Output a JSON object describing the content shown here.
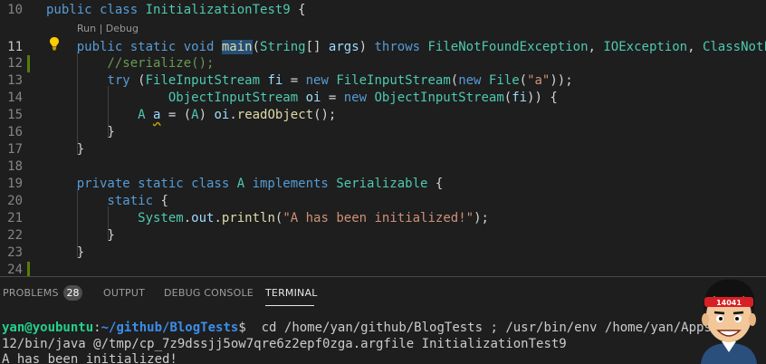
{
  "editor": {
    "codelens": "Run | Debug",
    "lines": [
      {
        "num": "10",
        "tokens": [
          {
            "t": "public class ",
            "c": "kw"
          },
          {
            "t": "InitializationTest9",
            "c": "ty"
          },
          {
            "t": " {",
            "c": "pl"
          }
        ]
      },
      {
        "num": "11",
        "tokens": [
          {
            "t": "    public static void ",
            "c": "kw"
          },
          {
            "t": "main",
            "c": "fn hl"
          },
          {
            "t": "(",
            "c": "pl"
          },
          {
            "t": "String",
            "c": "ty"
          },
          {
            "t": "[] ",
            "c": "pl"
          },
          {
            "t": "args",
            "c": "var"
          },
          {
            "t": ") ",
            "c": "pl"
          },
          {
            "t": "throws ",
            "c": "kw"
          },
          {
            "t": "FileNotFoundException",
            "c": "ty"
          },
          {
            "t": ", ",
            "c": "pl"
          },
          {
            "t": "IOException",
            "c": "ty"
          },
          {
            "t": ", ",
            "c": "pl"
          },
          {
            "t": "ClassNotF",
            "c": "ty"
          }
        ]
      },
      {
        "num": "12",
        "tokens": [
          {
            "t": "        //serialize();",
            "c": "cm"
          }
        ]
      },
      {
        "num": "13",
        "tokens": [
          {
            "t": "        try ",
            "c": "kw"
          },
          {
            "t": "(",
            "c": "pl"
          },
          {
            "t": "FileInputStream ",
            "c": "ty"
          },
          {
            "t": "fi",
            "c": "var"
          },
          {
            "t": " = ",
            "c": "pl"
          },
          {
            "t": "new ",
            "c": "kw"
          },
          {
            "t": "FileInputStream",
            "c": "ty"
          },
          {
            "t": "(",
            "c": "pl"
          },
          {
            "t": "new ",
            "c": "kw"
          },
          {
            "t": "File",
            "c": "ty"
          },
          {
            "t": "(",
            "c": "pl"
          },
          {
            "t": "\"a\"",
            "c": "str"
          },
          {
            "t": "));",
            "c": "pl"
          }
        ]
      },
      {
        "num": "14",
        "tokens": [
          {
            "t": "                ObjectInputStream ",
            "c": "ty"
          },
          {
            "t": "oi",
            "c": "var"
          },
          {
            "t": " = ",
            "c": "pl"
          },
          {
            "t": "new ",
            "c": "kw"
          },
          {
            "t": "ObjectInputStream",
            "c": "ty"
          },
          {
            "t": "(",
            "c": "pl"
          },
          {
            "t": "fi",
            "c": "var"
          },
          {
            "t": ")) {",
            "c": "pl"
          }
        ]
      },
      {
        "num": "15",
        "tokens": [
          {
            "t": "            A ",
            "c": "ty"
          },
          {
            "t": "a",
            "c": "var squig"
          },
          {
            "t": " = (",
            "c": "pl"
          },
          {
            "t": "A",
            "c": "ty"
          },
          {
            "t": ") ",
            "c": "pl"
          },
          {
            "t": "oi",
            "c": "var"
          },
          {
            "t": ".",
            "c": "pl"
          },
          {
            "t": "readObject",
            "c": "fn"
          },
          {
            "t": "();",
            "c": "pl"
          }
        ]
      },
      {
        "num": "16",
        "tokens": [
          {
            "t": "        }",
            "c": "pl"
          }
        ]
      },
      {
        "num": "17",
        "tokens": [
          {
            "t": "    }",
            "c": "pl"
          }
        ]
      },
      {
        "num": "18",
        "tokens": []
      },
      {
        "num": "19",
        "tokens": [
          {
            "t": "    private static class ",
            "c": "kw"
          },
          {
            "t": "A ",
            "c": "ty"
          },
          {
            "t": "implements ",
            "c": "kw"
          },
          {
            "t": "Serializable",
            "c": "ty"
          },
          {
            "t": " {",
            "c": "pl"
          }
        ]
      },
      {
        "num": "20",
        "tokens": [
          {
            "t": "        static ",
            "c": "kw"
          },
          {
            "t": "{",
            "c": "pl"
          }
        ]
      },
      {
        "num": "21",
        "tokens": [
          {
            "t": "            System",
            "c": "ty"
          },
          {
            "t": ".",
            "c": "pl"
          },
          {
            "t": "out",
            "c": "var"
          },
          {
            "t": ".",
            "c": "pl"
          },
          {
            "t": "println",
            "c": "fn"
          },
          {
            "t": "(",
            "c": "pl"
          },
          {
            "t": "\"A has been initialized!\"",
            "c": "str"
          },
          {
            "t": ");",
            "c": "pl"
          }
        ]
      },
      {
        "num": "22",
        "tokens": [
          {
            "t": "        }",
            "c": "pl"
          }
        ]
      },
      {
        "num": "23",
        "tokens": [
          {
            "t": "    }",
            "c": "pl"
          }
        ]
      },
      {
        "num": "24",
        "tokens": []
      }
    ]
  },
  "panel": {
    "tabs": [
      {
        "label": "PROBLEMS",
        "name": "tab-problems"
      },
      {
        "label": "OUTPUT",
        "name": "tab-output"
      },
      {
        "label": "DEBUG CONSOLE",
        "name": "tab-debug-console"
      },
      {
        "label": "TERMINAL",
        "name": "tab-terminal",
        "active": true
      }
    ],
    "problems_count": "28"
  },
  "terminal": {
    "prompt_user": "yan@youbuntu",
    "prompt_sep": ":",
    "prompt_path": "~/github/BlogTests",
    "prompt_end": "$",
    "command": "  cd /home/yan/github/BlogTests ; /usr/bin/env /home/yan/Apps/jdk",
    "line2": "12/bin/java @/tmp/cp_7z9dssjj5ow7qre6z2epf0zga.argfile InitializationTest9",
    "line3": "A has been initialized!"
  },
  "avatar": {
    "badge_text": "14041"
  }
}
